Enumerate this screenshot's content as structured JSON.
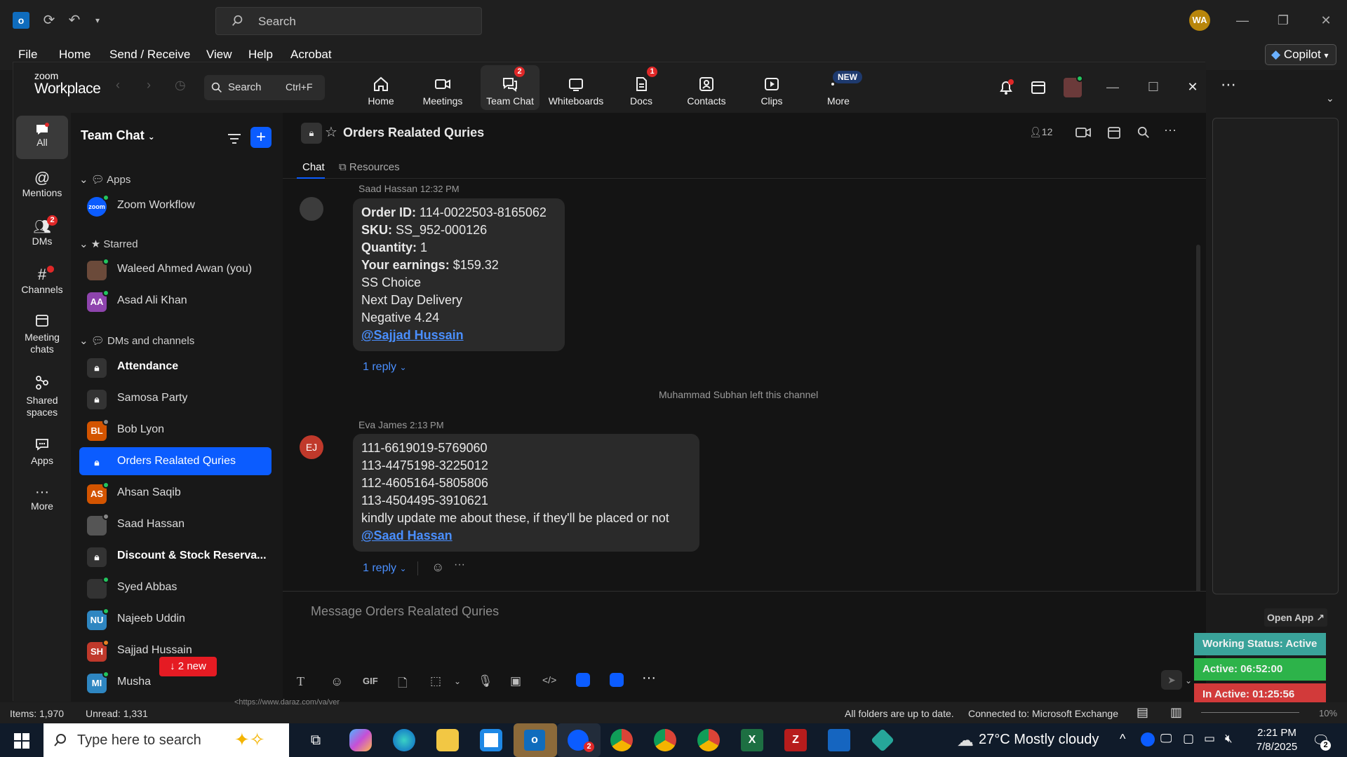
{
  "outlook": {
    "search_placeholder": "Search",
    "avatar": "WA",
    "menu": [
      "File",
      "Home",
      "Send / Receive",
      "View",
      "Help",
      "Acrobat"
    ],
    "copilot": "Copilot",
    "status_left": [
      "Items: 1,970",
      "Unread: 1,331"
    ],
    "status_right": [
      "All folders are up to date.",
      "Connected to: Microsoft Exchange"
    ],
    "zoom_percent": "10%",
    "url_fragment": "<https://www.daraz.com/va/ver"
  },
  "zoom": {
    "brand_top": "zoom",
    "brand_bottom": "Workplace",
    "search": {
      "label": "Search",
      "shortcut": "Ctrl+F"
    },
    "nav": [
      {
        "label": "Home",
        "icon": "home-icon"
      },
      {
        "label": "Meetings",
        "icon": "video-camera-icon"
      },
      {
        "label": "Team Chat",
        "icon": "chat-bubbles-icon",
        "badge": "2"
      },
      {
        "label": "Whiteboards",
        "icon": "whiteboard-icon"
      },
      {
        "label": "Docs",
        "icon": "document-icon",
        "badge": "1"
      },
      {
        "label": "Contacts",
        "icon": "contacts-icon"
      },
      {
        "label": "Clips",
        "icon": "clips-icon"
      },
      {
        "label": "More",
        "icon": "more-dots-icon",
        "new_badge": "NEW"
      }
    ],
    "rail": [
      {
        "label": "All",
        "icon": "chat-bubble-icon"
      },
      {
        "label": "Mentions",
        "icon": "at-sign-icon"
      },
      {
        "label": "DMs",
        "icon": "people-icon",
        "badge": "2"
      },
      {
        "label": "Channels",
        "icon": "hashtag-icon"
      },
      {
        "label": "Meeting chats",
        "icon": "calendar-icon"
      },
      {
        "label": "Shared spaces",
        "icon": "shared-spaces-icon"
      },
      {
        "label": "Apps",
        "icon": "apps-icon"
      },
      {
        "label": "More",
        "icon": "more-dots-icon"
      }
    ],
    "sidebar": {
      "title": "Team Chat",
      "sections": {
        "apps": "Apps",
        "starred": "Starred",
        "dms": "DMs and channels"
      },
      "apps": [
        {
          "name": "Zoom Workflow",
          "initials": "zoom",
          "color": "#0b5cff"
        }
      ],
      "starred": [
        {
          "name": "Waleed Ahmed Awan (you)",
          "initials": "",
          "color": "#6b4a3a"
        },
        {
          "name": "Asad Ali Khan",
          "initials": "AA",
          "color": "#8e44ad"
        }
      ],
      "channels": [
        {
          "name": "Attendance",
          "type": "lock",
          "bold": true
        },
        {
          "name": "Samosa Party",
          "type": "lock",
          "bold": false
        },
        {
          "name": "Bob Lyon",
          "initials": "BL",
          "color": "#d35400",
          "bold": false
        },
        {
          "name": "Orders Realated Quries",
          "type": "lock",
          "bold": false,
          "selected": true
        },
        {
          "name": "Ahsan Saqib",
          "initials": "AS",
          "color": "#d35400",
          "bold": false
        },
        {
          "name": "Saad Hassan",
          "initials": "",
          "color": "#555",
          "bold": false
        },
        {
          "name": "Discount & Stock Reserva...",
          "type": "lock",
          "bold": true
        },
        {
          "name": "Syed Abbas",
          "initials": "",
          "color": "#333",
          "bold": false
        },
        {
          "name": "Najeeb Uddin",
          "initials": "NU",
          "color": "#2e86c1",
          "bold": false
        },
        {
          "name": "Sajjad Hussain",
          "initials": "SH",
          "color": "#c0392b",
          "bold": false
        },
        {
          "name": "Musha",
          "initials": "MI",
          "color": "#2e86c1",
          "bold": false
        }
      ],
      "new_pill": "↓ 2 new"
    },
    "channel": {
      "title": "Orders Realated Quries",
      "members": "12",
      "tabs": [
        "Chat",
        "Resources"
      ]
    },
    "messages": [
      {
        "sender": "Saad Hassan",
        "time": "12:32 PM",
        "lines": [
          {
            "label": "Order ID:",
            "value": " 114-0022503-8165062"
          },
          {
            "label": "SKU:",
            "value": " SS_952-000126"
          },
          {
            "label": "Quantity:",
            "value": " 1"
          },
          {
            "label": "Your earnings:",
            "value": " $159.32"
          },
          {
            "label": "",
            "value": "SS Choice"
          },
          {
            "label": "",
            "value": "Next Day Delivery"
          },
          {
            "label": "",
            "value": "Negative 4.24"
          }
        ],
        "mention": "@Sajjad Hussain",
        "reply": "1 reply"
      },
      {
        "sender": "Eva James",
        "time": "2:13 PM",
        "initials": "EJ",
        "lines": [
          {
            "label": "",
            "value": "111-6619019-5769060"
          },
          {
            "label": "",
            "value": "113-4475198-3225012"
          },
          {
            "label": "",
            "value": "112-4605164-5805806"
          },
          {
            "label": "",
            "value": "113-4504495-3910621"
          },
          {
            "label": "",
            "value": "kindly update me about these, if they'll be placed or not"
          }
        ],
        "mention": "@Saad Hassan",
        "reply": "1 reply"
      }
    ],
    "system_message": "Muhammad Subhan left this channel",
    "composer_placeholder": "Message Orders Realated Quries",
    "composer_gif": "GIF"
  },
  "widget": {
    "open_app": "Open App ↗",
    "working_status": "Working Status: Active",
    "active": "Active: 06:52:00",
    "inactive": "In Active: 01:25:56"
  },
  "taskbar": {
    "search_placeholder": "Type here to search",
    "weather": "27°C  Mostly cloudy",
    "time": "2:21 PM",
    "date": "7/8/2025",
    "notif_count": "2",
    "zoom_badge": "2"
  }
}
